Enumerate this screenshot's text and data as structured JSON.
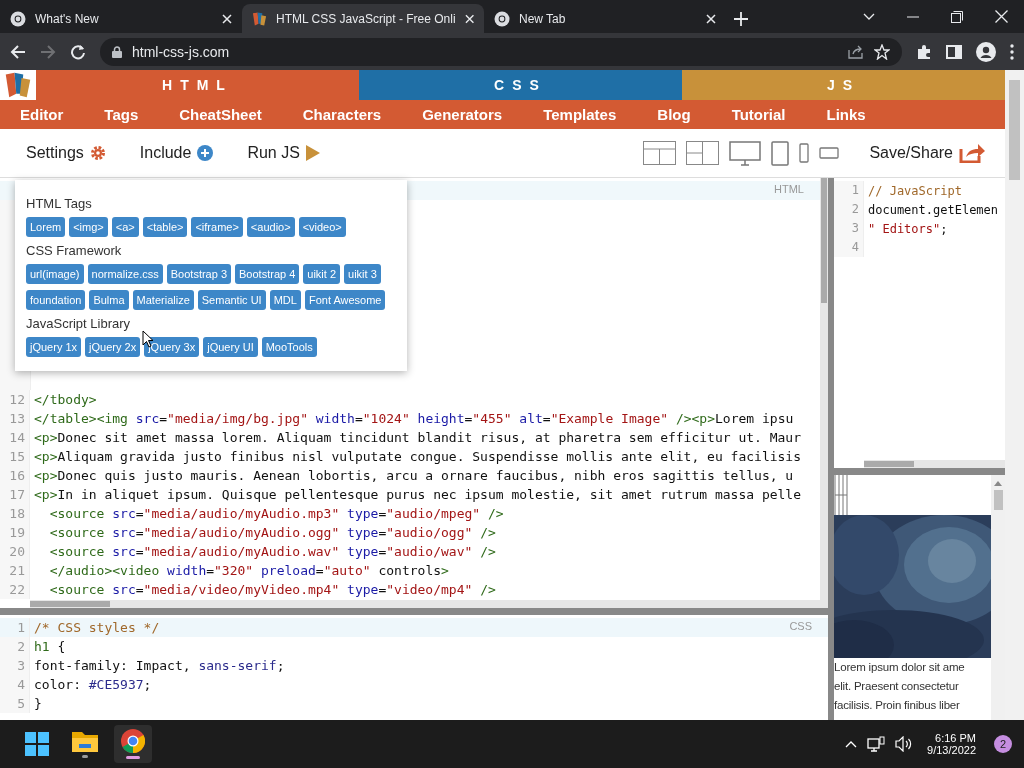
{
  "browser": {
    "tabs": [
      {
        "title": "What's New",
        "kind": "chrome",
        "selected": false
      },
      {
        "title": "HTML CSS JavaScript - Free Onli",
        "kind": "site",
        "selected": true
      },
      {
        "title": "New Tab",
        "kind": "chrome",
        "selected": false
      }
    ],
    "url": "html-css-js.com",
    "forward_disabled": true
  },
  "site": {
    "sections": [
      {
        "label": "HTML",
        "color": "#d35a33"
      },
      {
        "label": "CSS",
        "color": "#1f6fa6"
      },
      {
        "label": "JS",
        "color": "#c8913a"
      }
    ],
    "nav": [
      "Editor",
      "Tags",
      "CheatSheet",
      "Characters",
      "Generators",
      "Templates",
      "Blog",
      "Tutorial",
      "Links"
    ],
    "toolbar": [
      {
        "label": "Settings",
        "kind": "settings"
      },
      {
        "label": "Include",
        "kind": "include"
      },
      {
        "label": "Run JS",
        "kind": "run"
      }
    ],
    "save_share": "Save/Share"
  },
  "include_menu": {
    "groups": [
      {
        "title": "HTML Tags",
        "items": [
          "Lorem",
          "<img>",
          "<a>",
          "<table>",
          "<iframe>",
          "<audio>",
          "<video>"
        ]
      },
      {
        "title": "CSS Framework",
        "items": [
          "url(image)",
          "normalize.css",
          "Bootstrap 3",
          "Bootstrap 4",
          "uikit 2",
          "uikit 3",
          "foundation",
          "Bulma",
          "Materialize",
          "Semantic UI",
          "MDL",
          "Font Awesome"
        ]
      },
      {
        "title": "JavaScript Library",
        "items": [
          "jQuery 1x",
          "jQuery 2x",
          "jQuery 3x",
          "jQuery UI",
          "MooTools"
        ]
      }
    ]
  },
  "html_editor": {
    "label": "HTML",
    "lines": [
      {
        "number": "12",
        "code": "</tbody>"
      },
      {
        "number": "13",
        "code": "</table><img src=\"media/img/bg.jpg\" width=\"1024\" height=\"455\" alt=\"Example Image\" /><p>Lorem ipsu"
      },
      {
        "number": "14",
        "code": "<p>Donec sit amet massa lorem. Aliquam tincidunt blandit risus, at pharetra sem efficitur ut. Maur"
      },
      {
        "number": "15",
        "code": "<p>Aliquam gravida justo finibus nisl vulputate congue. Suspendisse mollis ante elit, eu facilisis"
      },
      {
        "number": "16",
        "code": "<p>Donec quis justo mauris. Aenean lobortis, arcu a ornare faucibus, nibh eros sagittis tellus, u"
      },
      {
        "number": "17",
        "code": "<p>In in aliquet ipsum. Quisque pellentesque purus nec ipsum molestie, sit amet rutrum massa pelle"
      },
      {
        "number": "18",
        "code": "  <source src=\"media/audio/myAudio.mp3\" type=\"audio/mpeg\" />"
      },
      {
        "number": "19",
        "code": "  <source src=\"media/audio/myAudio.ogg\" type=\"audio/ogg\" />"
      },
      {
        "number": "20",
        "code": "  <source src=\"media/audio/myAudio.wav\" type=\"audio/wav\" />"
      },
      {
        "number": "21",
        "code": "  </audio><video width=\"320\" preload=\"auto\" controls>"
      },
      {
        "number": "22",
        "code": "  <source src=\"media/video/myVideo.mp4\" type=\"video/mp4\" />"
      }
    ]
  },
  "css_editor": {
    "label": "CSS",
    "lines": [
      {
        "number": "1",
        "tokens": [
          {
            "text": "/* CSS styles */",
            "kind": "comment"
          }
        ]
      },
      {
        "number": "2",
        "tokens": [
          {
            "text": "h1",
            "kind": "tag"
          },
          {
            "text": " {",
            "kind": "plain"
          }
        ]
      },
      {
        "number": "3",
        "tokens": [
          {
            "text": "font-family: Impact, ",
            "kind": "plain"
          },
          {
            "text": "sans-serif",
            "kind": "atom"
          },
          {
            "text": ";",
            "kind": "plain"
          }
        ]
      },
      {
        "number": "4",
        "tokens": [
          {
            "text": "color: ",
            "kind": "plain"
          },
          {
            "text": "#CE5937",
            "kind": "atom"
          },
          {
            "text": ";",
            "kind": "plain"
          }
        ]
      },
      {
        "number": "5",
        "tokens": [
          {
            "text": "}",
            "kind": "plain"
          }
        ]
      }
    ]
  },
  "js_editor": {
    "lines": [
      {
        "number": "1",
        "tokens": [
          {
            "text": "// JavaScript",
            "kind": "comment"
          }
        ]
      },
      {
        "number": "2",
        "tokens": [
          {
            "text": "document.getElemen",
            "kind": "plain"
          }
        ]
      },
      {
        "number": "3",
        "tokens": [
          {
            "text": "\" Editors\"",
            "kind": "string"
          },
          {
            "text": ";",
            "kind": "plain"
          }
        ]
      },
      {
        "number": "4"
      }
    ]
  },
  "preview": {
    "picture": {
      "kind": "picture"
    },
    "lines": [
      "Lorem ipsum dolor sit ame",
      "elit. Praesent consectetur",
      "facilisis. Proin finibus liber"
    ]
  },
  "taskbar": {
    "apps": [
      {
        "kind": "folder",
        "selected": false
      },
      {
        "kind": "chrome",
        "selected": true
      }
    ],
    "time": "6:16 PM",
    "date": "9/13/2022",
    "notifications": "2"
  }
}
